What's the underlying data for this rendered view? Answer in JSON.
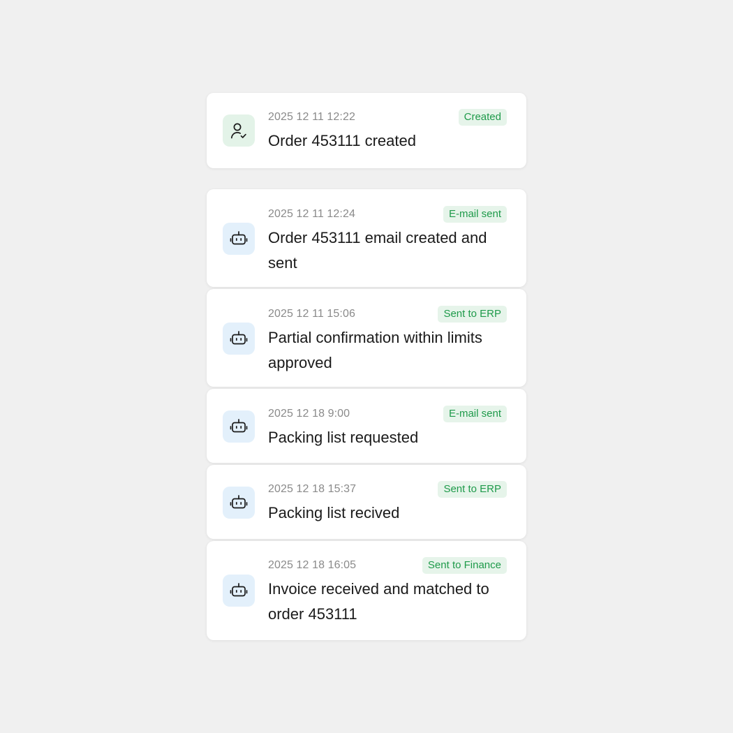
{
  "events": [
    {
      "timestamp": "2025 12 11 12:22",
      "badge": "Created",
      "title": "Order 453111 created",
      "icon": "user-check-icon"
    },
    {
      "timestamp": "2025 12 11 12:24",
      "badge": "E-mail sent",
      "title": "Order 453111 email created and sent",
      "icon": "robot-icon"
    },
    {
      "timestamp": "2025 12 11 15:06",
      "badge": "Sent to ERP",
      "title": "Partial confirmation within limits approved",
      "icon": "robot-icon"
    },
    {
      "timestamp": "2025 12 18 9:00",
      "badge": "E-mail sent",
      "title": "Packing list requested",
      "icon": "robot-icon"
    },
    {
      "timestamp": "2025 12 18 15:37",
      "badge": "Sent to ERP",
      "title": "Packing list recived",
      "icon": "robot-icon"
    },
    {
      "timestamp": "2025 12 18 16:05",
      "badge": "Sent to Finance",
      "title": "Invoice received and matched to order 453111",
      "icon": "robot-icon"
    }
  ],
  "colors": {
    "background": "#f0f0f0",
    "card": "#ffffff",
    "badge_bg": "#e6f4ea",
    "badge_text": "#1e9a4a",
    "user_icon_bg": "#e3f3e8",
    "bot_icon_bg": "#e3f0fb"
  }
}
